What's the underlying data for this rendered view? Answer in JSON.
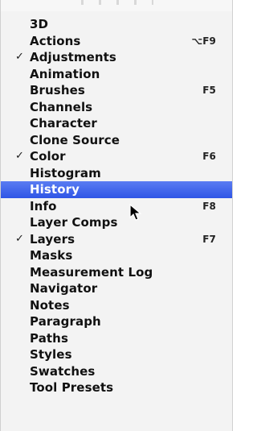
{
  "menu": {
    "items": [
      {
        "label": "3D",
        "checked": false,
        "shortcut": ""
      },
      {
        "label": "Actions",
        "checked": false,
        "shortcut": "⌥F9"
      },
      {
        "label": "Adjustments",
        "checked": true,
        "shortcut": ""
      },
      {
        "label": "Animation",
        "checked": false,
        "shortcut": ""
      },
      {
        "label": "Brushes",
        "checked": false,
        "shortcut": "F5"
      },
      {
        "label": "Channels",
        "checked": false,
        "shortcut": ""
      },
      {
        "label": "Character",
        "checked": false,
        "shortcut": ""
      },
      {
        "label": "Clone Source",
        "checked": false,
        "shortcut": ""
      },
      {
        "label": "Color",
        "checked": true,
        "shortcut": "F6"
      },
      {
        "label": "Histogram",
        "checked": false,
        "shortcut": ""
      },
      {
        "label": "History",
        "checked": false,
        "shortcut": "",
        "highlighted": true
      },
      {
        "label": "Info",
        "checked": false,
        "shortcut": "F8"
      },
      {
        "label": "Layer Comps",
        "checked": false,
        "shortcut": ""
      },
      {
        "label": "Layers",
        "checked": true,
        "shortcut": "F7"
      },
      {
        "label": "Masks",
        "checked": false,
        "shortcut": ""
      },
      {
        "label": "Measurement Log",
        "checked": false,
        "shortcut": ""
      },
      {
        "label": "Navigator",
        "checked": false,
        "shortcut": ""
      },
      {
        "label": "Notes",
        "checked": false,
        "shortcut": ""
      },
      {
        "label": "Paragraph",
        "checked": false,
        "shortcut": ""
      },
      {
        "label": "Paths",
        "checked": false,
        "shortcut": ""
      },
      {
        "label": "Styles",
        "checked": false,
        "shortcut": ""
      },
      {
        "label": "Swatches",
        "checked": false,
        "shortcut": ""
      },
      {
        "label": "Tool Presets",
        "checked": false,
        "shortcut": ""
      }
    ],
    "check_glyph": "✓",
    "highlight_color": "#3a5ff0"
  },
  "cursor": {
    "icon": "arrow-pointer-icon"
  }
}
